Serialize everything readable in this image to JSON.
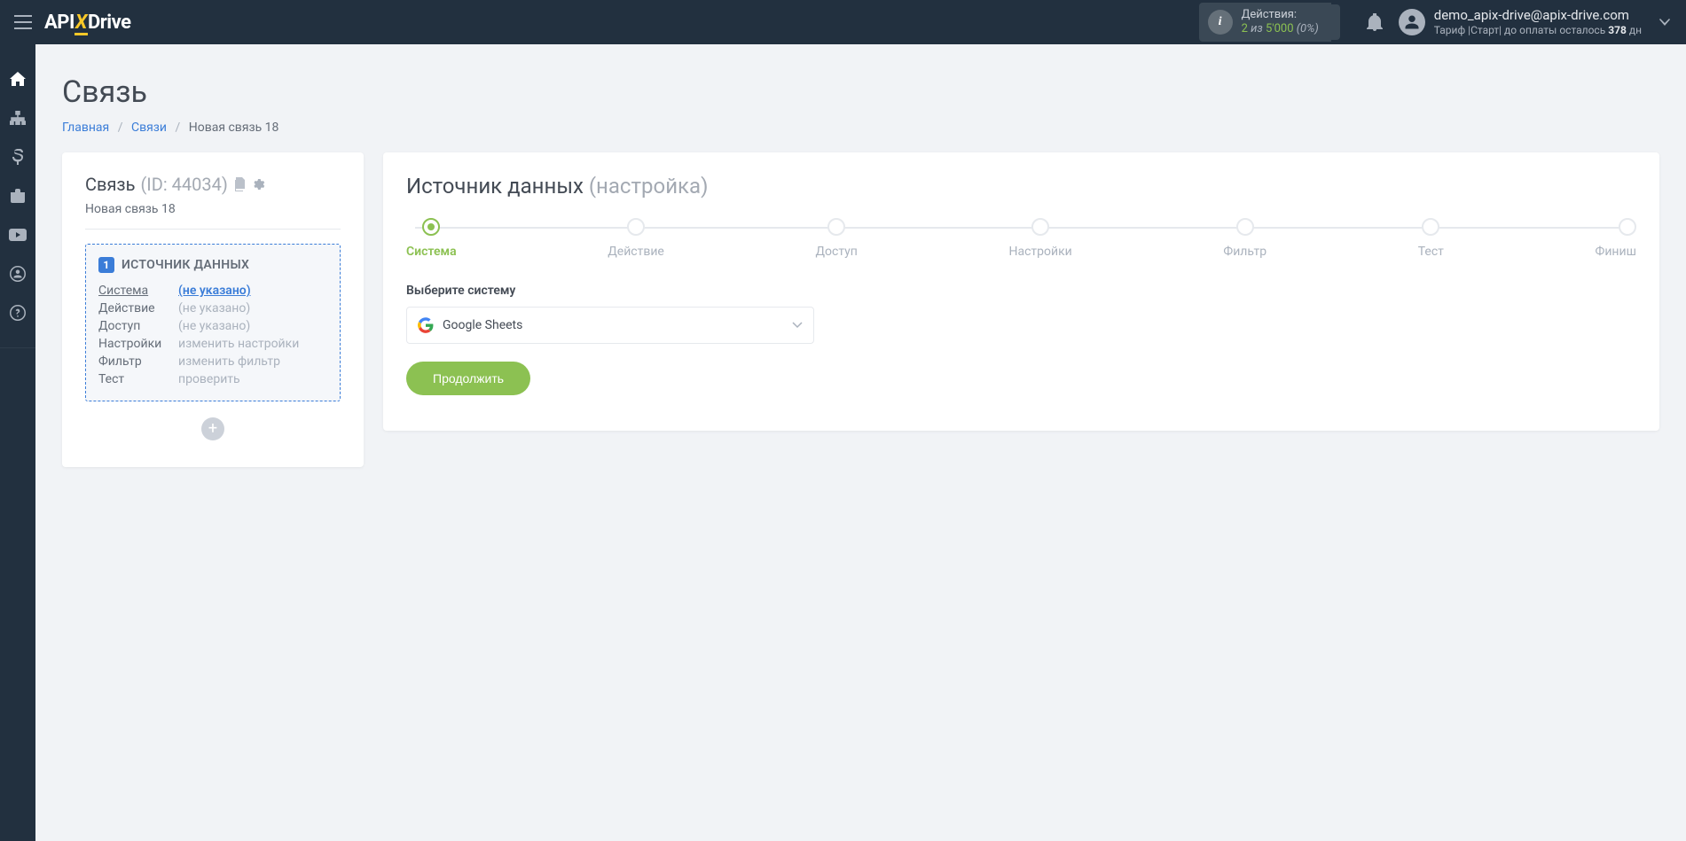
{
  "topbar": {
    "actions_label": "Действия:",
    "actions_used": "2",
    "actions_of": "из",
    "actions_total": "5'000",
    "actions_pct": "(0%)",
    "email": "demo_apix-drive@apix-drive.com",
    "tariff_prefix": "Тариф |",
    "tariff_name": "Старт",
    "tariff_mid": "| до оплаты осталось ",
    "tariff_days": "378",
    "tariff_suffix": " дн"
  },
  "page": {
    "title": "Связь",
    "breadcrumb_home": "Главная",
    "breadcrumb_links": "Связи",
    "breadcrumb_current": "Новая связь 18"
  },
  "left": {
    "label": "Связь",
    "id_text": "(ID: 44034)",
    "name": "Новая связь 18",
    "source_badge": "1",
    "source_title": "ИСТОЧНИК ДАННЫХ",
    "rows": {
      "system_k": "Система",
      "system_v": "(не указано)",
      "action_k": "Действие",
      "action_v": "(не указано)",
      "access_k": "Доступ",
      "access_v": "(не указано)",
      "settings_k": "Настройки",
      "settings_v": "изменить настройки",
      "filter_k": "Фильтр",
      "filter_v": "изменить фильтр",
      "test_k": "Тест",
      "test_v": "проверить"
    }
  },
  "right": {
    "title_main": "Источник данных",
    "title_muted": "(настройка)",
    "steps": [
      "Система",
      "Действие",
      "Доступ",
      "Настройки",
      "Фильтр",
      "Тест",
      "Финиш"
    ],
    "active_step_index": 0,
    "field_label": "Выберите систему",
    "selected_system": "Google Sheets",
    "continue": "Продолжить"
  },
  "colors": {
    "accent_green": "#8cc152",
    "accent_blue": "#3b7dd8",
    "dark": "#22303f"
  }
}
